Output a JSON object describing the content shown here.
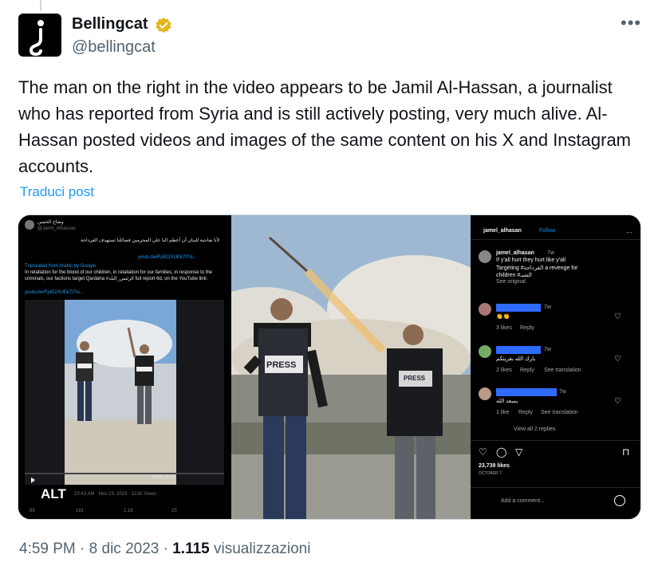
{
  "author": {
    "display_name": "Bellingcat",
    "handle": "@bellingcat"
  },
  "more_label": "•••",
  "tweet": {
    "text": "The man on the right in the video appears to be Jamil Al-Hassan, a journalist who has reported from Syria and is still actively posting, very much alive. Al-Hassan posted videos and images of the same content on his X and Instagram accounts.",
    "translate_label": "Traduci post"
  },
  "media": {
    "alt_label": "ALT",
    "left_panel": {
      "account_name": "وضاح الحسن",
      "account_handle": "@Jamil_Alhassan",
      "arabic_text": "لأنا ضاحية للبنان أن أعظم البا على المجرمين فصائلنا تستهدف القرداحة",
      "link_1": "youtu.be/FpiD2XUEk7I?si...",
      "translated_from": "Translated from Arabic by Google",
      "translation": "In retaliation for the blood of our children, in retaliation for our families, in response to the criminals, our factions target Qardaha #الرئيس_البلد full report 6d, on the YouTube link:",
      "link_2": "youtu.be/FpiD2XUEk7I?si...",
      "video_time": "0:09 / 2:23",
      "post_meta": "10:43 AM · Nov 23, 2023 · 121K Views",
      "actions": [
        "88",
        "181",
        "1.1K",
        "25"
      ]
    },
    "middle_panel": {
      "vest_left": "PRESS",
      "vest_right": "PRESS"
    },
    "right_panel": {
      "username": "jamel_alhasan",
      "follow_label": "Follow",
      "caption_user": "jamel_alhasan",
      "caption_age": "7w",
      "caption_lines": [
        "If y'all hurt they hurt like y'all",
        "Targeting #القرداحة a revenge for",
        "children #الشبـ"
      ],
      "see_original": "See original",
      "comments": [
        {
          "age": "7w",
          "text": "👏👏",
          "likes": "3 likes",
          "reply": "Reply",
          "extra": ""
        },
        {
          "age": "7w",
          "text": "بارك الله بقريتكم",
          "likes": "2 likes",
          "reply": "Reply",
          "extra": "See translation"
        },
        {
          "age": "7w",
          "text": "يسعد الله",
          "likes": "1 like",
          "reply": "Reply",
          "extra": "See translation"
        }
      ],
      "view_replies": "View all 2 replies",
      "likes_count": "23,739 likes",
      "date": "OCTOBER 7",
      "add_comment": "Add a comment..."
    }
  },
  "footer": {
    "time": "4:59 PM",
    "date": "8 dic 2023",
    "views_count": "1.115",
    "views_label": "visualizzazioni"
  },
  "colors": {
    "link": "#1d9bf0",
    "secondary_text": "#536471",
    "verified_gold": "#e2b719"
  }
}
